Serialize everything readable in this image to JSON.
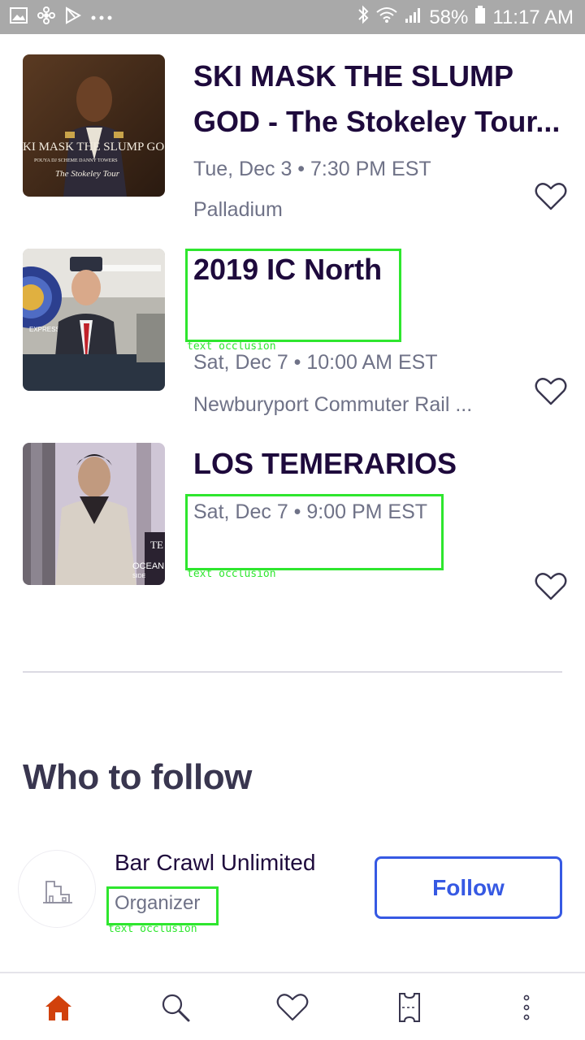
{
  "status_bar": {
    "battery": "58%",
    "time": "11:17 AM",
    "left_icons": [
      "gallery-icon",
      "fan-icon",
      "play-store-icon",
      "more-dots-icon"
    ],
    "right_icons": [
      "bluetooth-icon",
      "wifi-icon",
      "signal-icon",
      "battery-icon"
    ]
  },
  "events": [
    {
      "title": "SKI MASK THE SLUMP GOD - The Stokeley Tour...",
      "date": "Tue, Dec 3 • 7:30 PM EST",
      "venue": "Palladium",
      "thumb_text_main": "KI MASK THE SLUMP GO",
      "thumb_text_sub": "POUYA     DJ SCHEME     DANNY TOWERS",
      "thumb_text_script": "The Stokeley Tour"
    },
    {
      "title": "2019 IC North",
      "date": "Sat, Dec 7 • 10:00 AM EST",
      "venue": "Newburyport Commuter Rail ...",
      "thumb_text_main": "EXPRESS"
    },
    {
      "title": "LOS TEMERARIOS",
      "date": "Sat, Dec 7 • 9:00 PM EST",
      "venue": "",
      "thumb_text_main": "OCEAN",
      "thumb_text_sub": "SIDE",
      "thumb_text_corner": "TE"
    }
  ],
  "occlusion_label": "text occlusion",
  "who_to_follow": {
    "heading": "Who to follow",
    "organizer": {
      "name": "Bar Crawl Unlimited",
      "type": "Organizer",
      "button_label": "Follow"
    }
  },
  "bottom_nav": [
    "home-icon",
    "search-icon",
    "heart-icon",
    "ticket-icon",
    "more-vertical-icon"
  ],
  "colors": {
    "status_bar": "#a9a9a9",
    "title": "#1e0a3c",
    "secondary_text": "#6f7287",
    "follow_blue": "#3659e3",
    "home_active": "#d1410c",
    "occlusion_green": "#2ee62e"
  }
}
